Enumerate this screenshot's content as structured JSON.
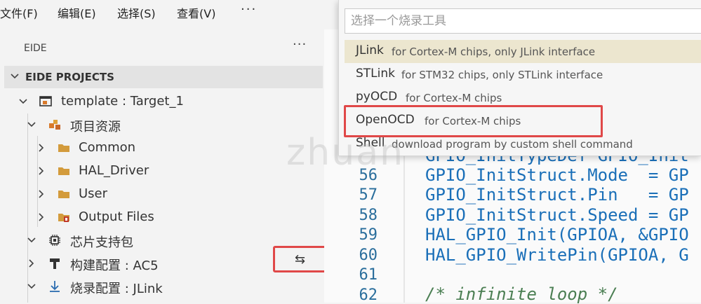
{
  "menu": {
    "file": "文件(F)",
    "edit": "编辑(E)",
    "select": "选择(S)",
    "view": "查看(V)",
    "more": "···"
  },
  "sidebar": {
    "title": "EIDE",
    "more": "···",
    "section": "EIDE PROJECTS",
    "items": [
      {
        "label": "template : Target_1",
        "icon": "project-icon"
      },
      {
        "label": "项目资源",
        "icon": "resources-icon"
      },
      {
        "label": "Common",
        "icon": "folder-icon"
      },
      {
        "label": "HAL_Driver",
        "icon": "folder-icon"
      },
      {
        "label": "User",
        "icon": "folder-icon"
      },
      {
        "label": "Output Files",
        "icon": "output-folder-icon"
      },
      {
        "label": "芯片支持包",
        "icon": "chip-icon"
      },
      {
        "label": "构建配置 : AC5",
        "icon": "hammer-icon"
      },
      {
        "label": "烧录配置 : JLink",
        "icon": "download-icon"
      }
    ],
    "swap_glyph": "⇆"
  },
  "quickpick": {
    "placeholder": "选择一个烧录工具",
    "items": [
      {
        "name": "JLink",
        "desc": "for Cortex-M chips, only JLink interface"
      },
      {
        "name": "STLink",
        "desc": "for STM32 chips, only STLink interface"
      },
      {
        "name": "pyOCD",
        "desc": "for Cortex-M chips"
      },
      {
        "name": "OpenOCD",
        "desc": "for Cortex-M chips"
      },
      {
        "name": "Shell",
        "desc": "download program by custom shell command"
      }
    ]
  },
  "editor": {
    "lines": [
      {
        "num": "56",
        "code": "GPIO_InitStruct.Mode  = GP"
      },
      {
        "num": "57",
        "code": "GPIO_InitStruct.Pin   = GP"
      },
      {
        "num": "58",
        "code": "GPIO_InitStruct.Speed = GP"
      },
      {
        "num": "59",
        "code": "HAL_GPIO_Init(GPIOA, &GPIO"
      },
      {
        "num": "60",
        "code": "HAL_GPIO_WritePin(GPIOA, G"
      },
      {
        "num": "61",
        "code": ""
      },
      {
        "num": "62",
        "code": "/* infinite loop */"
      }
    ],
    "partial_line": "GPIO_InitTypeDef GPIO_Init"
  },
  "watermark": "zhuan",
  "colors": {
    "highlight_border": "#e04848",
    "active_item_bg": "#ece6cf",
    "code_blue": "#1a6fb8",
    "folder": "#d39b3c"
  }
}
